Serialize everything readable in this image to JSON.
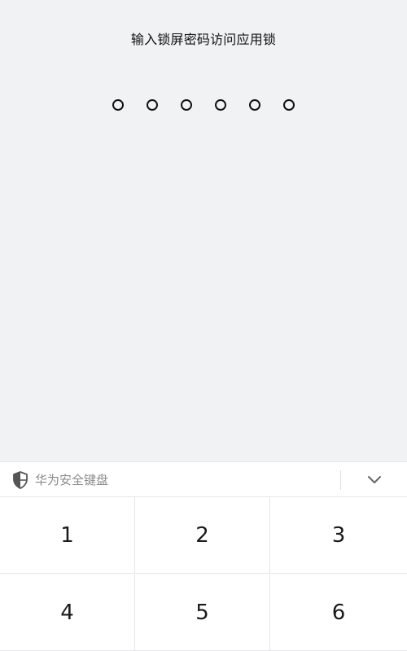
{
  "title": "输入锁屏密码访问应用锁",
  "pin": {
    "length": 6,
    "filled": 0
  },
  "keyboard": {
    "label": "华为安全键盘",
    "shield_icon": "shield-icon",
    "collapse_icon": "chevron-down-icon",
    "keys": [
      "1",
      "2",
      "3",
      "4",
      "5",
      "6"
    ]
  },
  "colors": {
    "background": "#f1f2f4",
    "keyboard_bg": "#ffffff",
    "text": "#111111",
    "label_gray": "#8a8a8e"
  }
}
